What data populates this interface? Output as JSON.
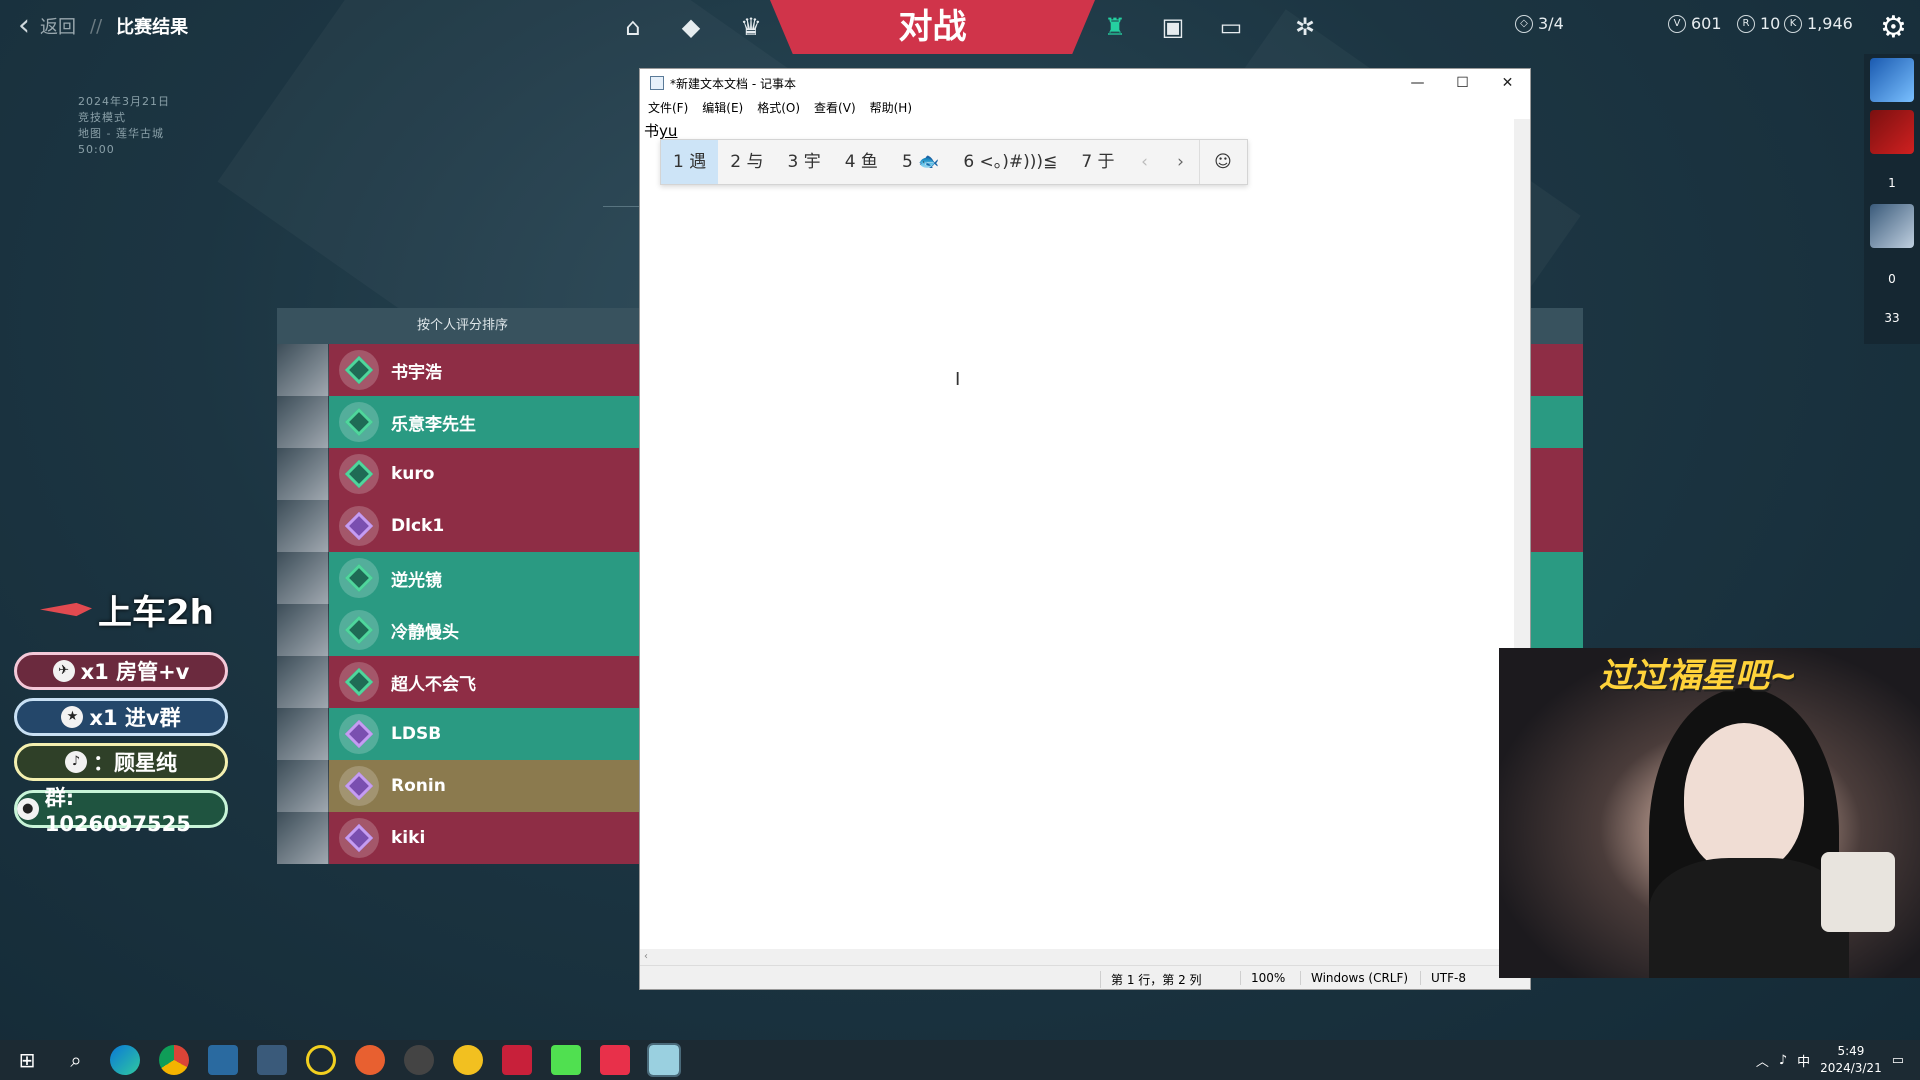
{
  "topbar": {
    "back_label": "返回",
    "separator": "//",
    "page_title": "比赛结果",
    "battle_tab": "对战",
    "kc_progress": "3/4",
    "valorant_points": "601",
    "radianite_points": "10",
    "kingdom_credits": "1,946"
  },
  "match_info": {
    "date": "2024年3月21日",
    "mode": "竞技模式",
    "map": "地图 - 莲华古城",
    "duration": "50:00"
  },
  "scoreboard": {
    "header": "按个人评分排序",
    "players": [
      {
        "name": "书宇浩",
        "team": "red",
        "rank": "diamond"
      },
      {
        "name": "乐意李先生",
        "team": "green",
        "rank": "diamond"
      },
      {
        "name": "kuro",
        "team": "red",
        "rank": "diamond"
      },
      {
        "name": "Dlck1",
        "team": "red",
        "rank": "plat"
      },
      {
        "name": "逆光镜",
        "team": "green",
        "rank": "diamond"
      },
      {
        "name": "冷静慢头",
        "team": "green",
        "rank": "diamond"
      },
      {
        "name": "超人不会飞",
        "team": "red",
        "rank": "diamond"
      },
      {
        "name": "LDSB",
        "team": "green",
        "rank": "plat"
      },
      {
        "name": "Ronin",
        "team": "gold",
        "rank": "plat"
      },
      {
        "name": "kiki",
        "team": "red",
        "rank": "plat"
      }
    ]
  },
  "overlay": {
    "title": "上车2h",
    "pill1": "x1 房管+v",
    "pill2": "x1 进v群",
    "pill3": "：顾星纯",
    "pill4": "群: 1026097525"
  },
  "notepad": {
    "title": "*新建文本文档 - 记事本",
    "menu": [
      "文件(F)",
      "编辑(E)",
      "格式(O)",
      "查看(V)",
      "帮助(H)"
    ],
    "text_committed": "书",
    "text_composing": "yu",
    "status_position": "第 1 行，第 2 列",
    "status_zoom": "100%",
    "status_eol": "Windows (CRLF)",
    "status_encoding": "UTF-8",
    "hscroll_arrow": "‹"
  },
  "ime": {
    "candidates": [
      "1 遇",
      "2 与",
      "3 宇",
      "4 鱼",
      "5 🐟",
      "6 <。)#)))≦",
      "7 于"
    ]
  },
  "right_sidebar": {
    "count1": "1",
    "count2": "0",
    "count3": "33"
  },
  "webcam": {
    "caption": "过过福星吧~"
  },
  "taskbar": {
    "time": "5:49",
    "date": "2024/3/21",
    "ime_indicator": "中"
  },
  "colors": {
    "team_red": "#8e2d45",
    "team_green": "#2a9a82",
    "battle_tab": "#d0344a"
  }
}
